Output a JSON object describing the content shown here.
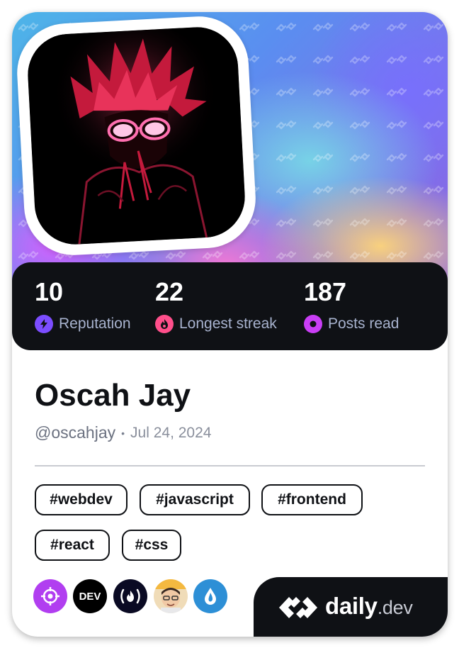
{
  "profile": {
    "name": "Oscah Jay",
    "handle": "@oscahjay",
    "separator": "•",
    "joined": "Jul 24, 2024"
  },
  "stats": [
    {
      "value": "10",
      "label": "Reputation",
      "icon": "lightning-icon",
      "color": "#7c4dff"
    },
    {
      "value": "22",
      "label": "Longest streak",
      "icon": "flame-icon",
      "color": "#ff4f8b"
    },
    {
      "value": "187",
      "label": "Posts read",
      "icon": "eye-ring-icon",
      "color": "#c93ef5"
    }
  ],
  "tags": [
    "#webdev",
    "#javascript",
    "#frontend",
    "#react",
    "#css"
  ],
  "sources": [
    {
      "name": "crosshair-source-icon",
      "color": "#b13ef0"
    },
    {
      "name": "dev-to-source-icon",
      "text": "DEV",
      "color": "#000000"
    },
    {
      "name": "freecodecamp-source-icon",
      "text": "(🔥)",
      "color": "#0a0a23"
    },
    {
      "name": "memoji-avatar-source-icon",
      "color": "#f2d4a0"
    },
    {
      "name": "water-drop-source-icon",
      "color": "#2d8fd6"
    }
  ],
  "brand": {
    "name": "daily",
    "tld": ".dev"
  },
  "colors": {
    "card_dark": "#0f1115",
    "label_gray": "#a8b3cf",
    "accent_purple": "#7c4dff",
    "accent_pink": "#ff4f8b"
  }
}
